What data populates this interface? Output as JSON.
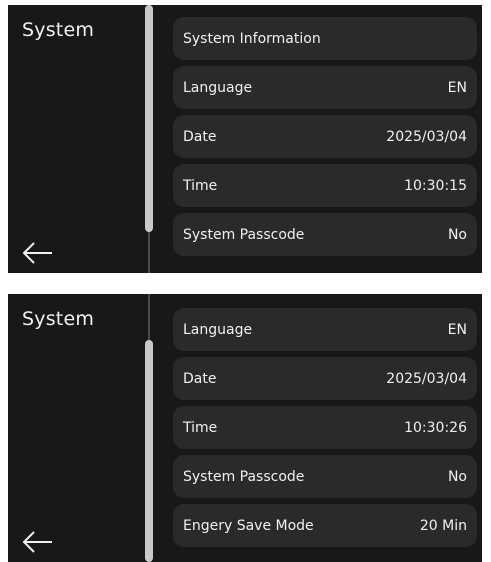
{
  "screens": [
    {
      "title": "System",
      "back_icon": "arrow-left-icon",
      "items": [
        {
          "label": "System Information",
          "value": ""
        },
        {
          "label": "Language",
          "value": "EN"
        },
        {
          "label": "Date",
          "value": "2025/03/04"
        },
        {
          "label": "Time",
          "value": "10:30:15"
        },
        {
          "label": "System Passcode",
          "value": "No"
        }
      ]
    },
    {
      "title": "System",
      "back_icon": "arrow-left-icon",
      "items": [
        {
          "label": "Language",
          "value": "EN"
        },
        {
          "label": "Date",
          "value": "2025/03/04"
        },
        {
          "label": "Time",
          "value": "10:30:26"
        },
        {
          "label": "System Passcode",
          "value": "No"
        },
        {
          "label": "Engery Save Mode",
          "value": "20 Min"
        }
      ]
    }
  ],
  "colors": {
    "background": "#181818",
    "row": "#2a2a2a",
    "text": "#f0f0f0",
    "scrollbar": "#c9c9c9"
  }
}
